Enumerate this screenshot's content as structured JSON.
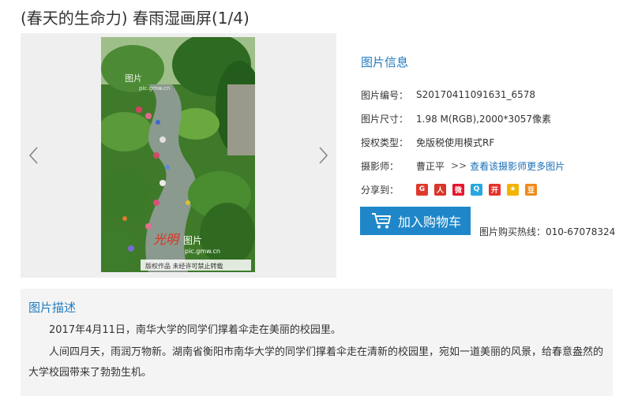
{
  "page": {
    "title": "(春天的生命力) 春雨湿画屏(1/4)"
  },
  "viewer": {
    "prev_icon": "chevron-left-icon",
    "next_icon": "chevron-right-icon",
    "watermark_top": "图片",
    "watermark_top_url": "pic.gmw.cn",
    "watermark_bottom_brand": "光明",
    "watermark_bottom": "图片",
    "watermark_bottom_url": "pic.gmw.cn",
    "caption": "版权作品   未经许可禁止转载"
  },
  "info": {
    "title": "图片信息",
    "rows": [
      {
        "label": "图片编号：",
        "value": "S20170411091631_6578"
      },
      {
        "label": "图片尺寸：",
        "value": "1.98 M(RGB),2000*3057像素"
      },
      {
        "label": "授权类型：",
        "value": "免版税使用模式RF"
      },
      {
        "label": "摄影师：",
        "value": "曹正平",
        "sep": ">>",
        "link": "查看该摄影师更多图片"
      }
    ],
    "share_label": "分享到：",
    "share_icons": [
      {
        "name": "google-icon",
        "glyph": "G",
        "color": "#e0392b"
      },
      {
        "name": "renren-icon",
        "glyph": "人",
        "color": "#d9362a"
      },
      {
        "name": "weibo-icon",
        "glyph": "微",
        "color": "#e6162d"
      },
      {
        "name": "qq-space-icon",
        "glyph": "Q",
        "color": "#27a7e0"
      },
      {
        "name": "kaixin-icon",
        "glyph": "开",
        "color": "#e6322b"
      },
      {
        "name": "qzone-star-icon",
        "glyph": "★",
        "color": "#f2b400"
      },
      {
        "name": "douban-icon",
        "glyph": "豆",
        "color": "#f08a1d"
      }
    ]
  },
  "cart": {
    "label": "加入购物车",
    "icon": "cart-icon",
    "color": "#1f87c9"
  },
  "hotline": "图片购买热线：010-67078324",
  "description": {
    "title": "图片描述",
    "paragraphs": [
      "2017年4月11日，南华大学的同学们撑着伞走在美丽的校园里。",
      "人间四月天，雨润万物新。湖南省衡阳市南华大学的同学们撑着伞走在清新的校园里，宛如一道美丽的风景，给春意盎然的大学校园带来了勃勃生机。"
    ]
  }
}
